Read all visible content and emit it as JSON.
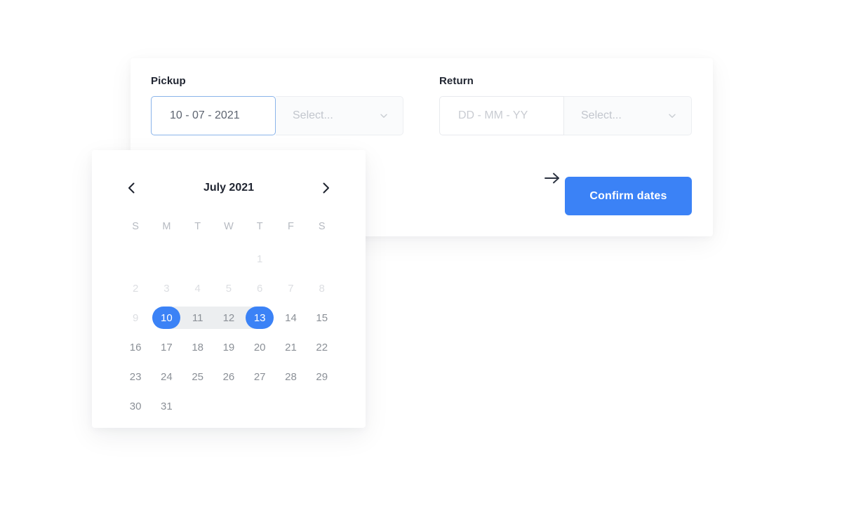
{
  "booking": {
    "pickup": {
      "label": "Pickup",
      "date_value": "10 - 07 - 2021",
      "date_placeholder": "DD - MM - YY",
      "time_value": "Select...",
      "focused": true
    },
    "return": {
      "label": "Return",
      "date_value": "",
      "date_placeholder": "DD - MM - YY",
      "time_value": "Select...",
      "focused": false
    },
    "separator_icon": "arrow-right-icon",
    "confirm_label": "Confirm dates"
  },
  "calendar": {
    "title": "July 2021",
    "prev_icon": "chevron-left-icon",
    "next_icon": "chevron-right-icon",
    "weekdays": [
      "S",
      "M",
      "T",
      "W",
      "T",
      "F",
      "S"
    ],
    "weeks": [
      [
        {
          "label": "",
          "state": "empty"
        },
        {
          "label": "",
          "state": "empty"
        },
        {
          "label": "",
          "state": "empty"
        },
        {
          "label": "",
          "state": "empty"
        },
        {
          "label": "1",
          "state": "disabled"
        },
        {
          "label": "",
          "state": "empty"
        },
        {
          "label": "",
          "state": "empty"
        }
      ],
      [
        {
          "label": "2",
          "state": "disabled"
        },
        {
          "label": "3",
          "state": "disabled"
        },
        {
          "label": "4",
          "state": "disabled"
        },
        {
          "label": "5",
          "state": "disabled"
        },
        {
          "label": "6",
          "state": "disabled"
        },
        {
          "label": "7",
          "state": "disabled"
        },
        {
          "label": "8",
          "state": "disabled"
        }
      ],
      [
        {
          "label": "9",
          "state": "disabled"
        },
        {
          "label": "10",
          "state": "range-start"
        },
        {
          "label": "11",
          "state": "in-range"
        },
        {
          "label": "12",
          "state": "in-range"
        },
        {
          "label": "13",
          "state": "range-end"
        },
        {
          "label": "14",
          "state": "normal"
        },
        {
          "label": "15",
          "state": "normal"
        }
      ],
      [
        {
          "label": "16",
          "state": "normal"
        },
        {
          "label": "17",
          "state": "normal"
        },
        {
          "label": "18",
          "state": "normal"
        },
        {
          "label": "19",
          "state": "normal"
        },
        {
          "label": "20",
          "state": "normal"
        },
        {
          "label": "21",
          "state": "normal"
        },
        {
          "label": "22",
          "state": "normal"
        }
      ],
      [
        {
          "label": "23",
          "state": "normal"
        },
        {
          "label": "24",
          "state": "normal"
        },
        {
          "label": "25",
          "state": "normal"
        },
        {
          "label": "26",
          "state": "normal"
        },
        {
          "label": "27",
          "state": "normal"
        },
        {
          "label": "28",
          "state": "normal"
        },
        {
          "label": "29",
          "state": "normal"
        }
      ],
      [
        {
          "label": "30",
          "state": "normal"
        },
        {
          "label": "31",
          "state": "normal"
        },
        {
          "label": "",
          "state": "empty"
        },
        {
          "label": "",
          "state": "empty"
        },
        {
          "label": "",
          "state": "empty"
        },
        {
          "label": "",
          "state": "empty"
        },
        {
          "label": "",
          "state": "empty"
        }
      ]
    ]
  },
  "colors": {
    "accent": "#3b82f6",
    "range_band": "#eceef0",
    "focus_border": "#8ab4ea",
    "text_dark": "#1f2430",
    "text_muted": "#8b9097",
    "text_disabled": "#dcdee2",
    "page_background": "#ffffff"
  }
}
